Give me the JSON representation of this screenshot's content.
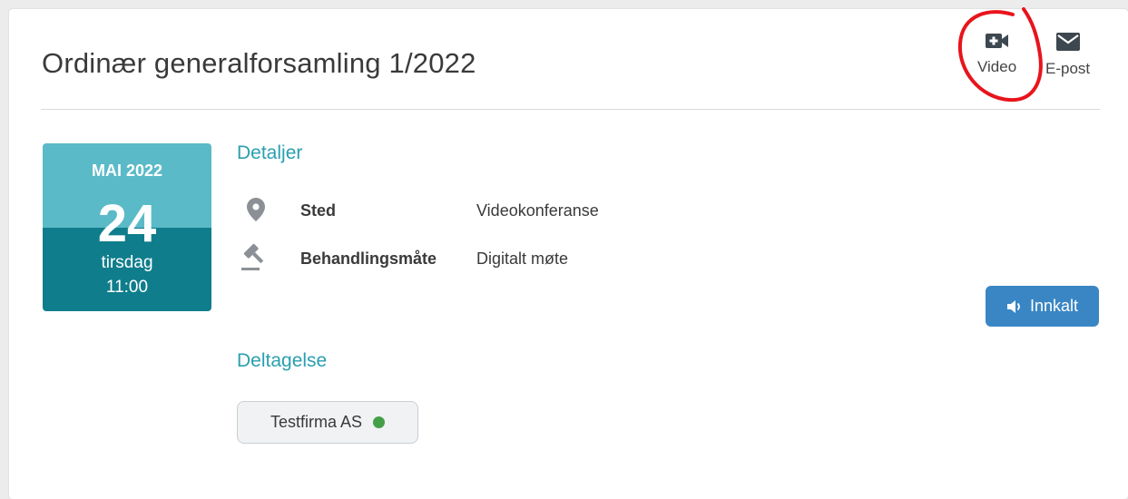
{
  "meeting": {
    "title": "Ordinær generalforsamling 1/2022"
  },
  "actions": {
    "video": {
      "label": "Video",
      "icon": "video-camera-icon"
    },
    "email": {
      "label": "E-post",
      "icon": "envelope-icon"
    }
  },
  "date": {
    "month_year": "MAI 2022",
    "day": "24",
    "weekday": "tirsdag",
    "time": "11:00"
  },
  "details": {
    "heading": "Detaljer",
    "rows": [
      {
        "label": "Sted",
        "value": "Videokonferanse",
        "icon": "map-pin-icon"
      },
      {
        "label": "Behandlingsmåte",
        "value": "Digitalt møte",
        "icon": "gavel-icon"
      }
    ]
  },
  "status": {
    "label": "Innkalt",
    "icon": "speaker-icon"
  },
  "participation": {
    "heading": "Deltagelse",
    "participants": [
      {
        "name": "Testfirma AS",
        "status_color": "#43a047"
      }
    ]
  },
  "colors": {
    "accent": "#2a9fb0",
    "date_top": "#5bbac7",
    "date_bottom": "#0f7d8c",
    "status_button": "#3a86c4",
    "annotation": "#e8141c"
  }
}
